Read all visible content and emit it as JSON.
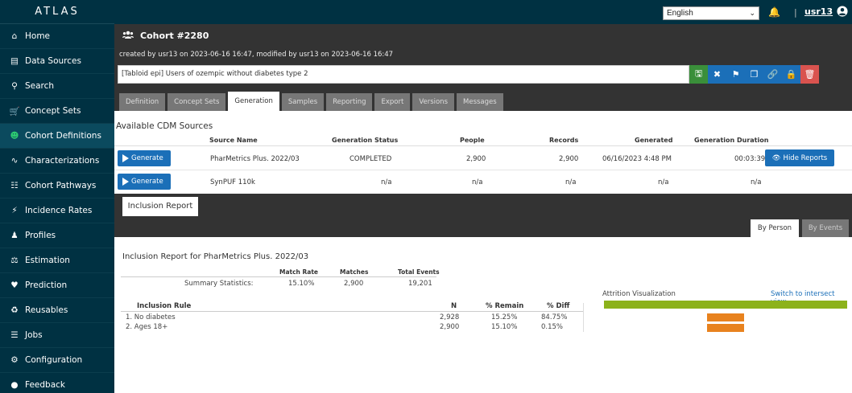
{
  "brand": "ATLAS",
  "sidebar": {
    "items": [
      {
        "label": "Home",
        "icon": "home-icon"
      },
      {
        "label": "Data Sources",
        "icon": "database-icon"
      },
      {
        "label": "Search",
        "icon": "search-icon"
      },
      {
        "label": "Concept Sets",
        "icon": "cart-icon"
      },
      {
        "label": "Cohort Definitions",
        "icon": "users-icon",
        "active": true
      },
      {
        "label": "Characterizations",
        "icon": "line-chart-icon"
      },
      {
        "label": "Cohort Pathways",
        "icon": "sitemap-icon"
      },
      {
        "label": "Incidence Rates",
        "icon": "bolt-icon"
      },
      {
        "label": "Profiles",
        "icon": "user-icon"
      },
      {
        "label": "Estimation",
        "icon": "balance-scale-icon"
      },
      {
        "label": "Prediction",
        "icon": "heartbeat-icon"
      },
      {
        "label": "Reusables",
        "icon": "recycle-icon"
      },
      {
        "label": "Jobs",
        "icon": "list-icon"
      },
      {
        "label": "Configuration",
        "icon": "cogs-icon"
      },
      {
        "label": "Feedback",
        "icon": "comment-icon"
      }
    ]
  },
  "topbar": {
    "language": "English",
    "username": "usr13"
  },
  "cohort": {
    "title": "Cohort #2280",
    "created": "created by usr13 on 2023-06-16 16:47, modified by usr13 on 2023-06-16 16:47",
    "name": "[Tabloid epi] Users of ozempic without diabetes type 2",
    "tabs": [
      "Definition",
      "Concept Sets",
      "Generation",
      "Samples",
      "Reporting",
      "Export",
      "Versions",
      "Messages"
    ],
    "active_tab": "Generation"
  },
  "sources": {
    "title": "Available CDM Sources",
    "headers": [
      "Source Name",
      "Generation Status",
      "People",
      "Records",
      "Generated",
      "Generation Duration"
    ],
    "generate_label": "Generate",
    "hide_reports_label": "Hide Reports",
    "rows": [
      {
        "name": "PharMetrics Plus. 2022/03",
        "status": "COMPLETED",
        "people": "2,900",
        "records": "2,900",
        "generated": "06/16/2023 4:48 PM",
        "duration": "00:03:39"
      },
      {
        "name": "SynPUF 110k",
        "status": "n/a",
        "people": "n/a",
        "records": "n/a",
        "generated": "n/a",
        "duration": "n/a"
      }
    ]
  },
  "inclusion": {
    "tab_label": "Inclusion Report",
    "by_person": "By Person",
    "by_events": "By Events",
    "report_title": "Inclusion Report for PharMetrics Plus. 2022/03",
    "summary_headers": [
      "Match Rate",
      "Matches",
      "Total Events"
    ],
    "summary_label": "Summary Statistics:",
    "summary_values": [
      "15.10%",
      "2,900",
      "19,201"
    ],
    "rule_headers": [
      "Inclusion Rule",
      "N",
      "% Remain",
      "% Diff"
    ],
    "rules": [
      {
        "label": "1.  No diabetes",
        "n": "2,928",
        "remain": "15.25%",
        "diff": "84.75%",
        "remain_fraction": 0.1525
      },
      {
        "label": "2.  Ages 18+",
        "n": "2,900",
        "remain": "15.10%",
        "diff": "0.15%",
        "remain_fraction": 0.151
      }
    ],
    "attrition_title": "Attrition Visualization",
    "switch_label": "Switch to intersect view",
    "colors": {
      "total": "#8cb21b",
      "remain": "#e8821e"
    }
  }
}
